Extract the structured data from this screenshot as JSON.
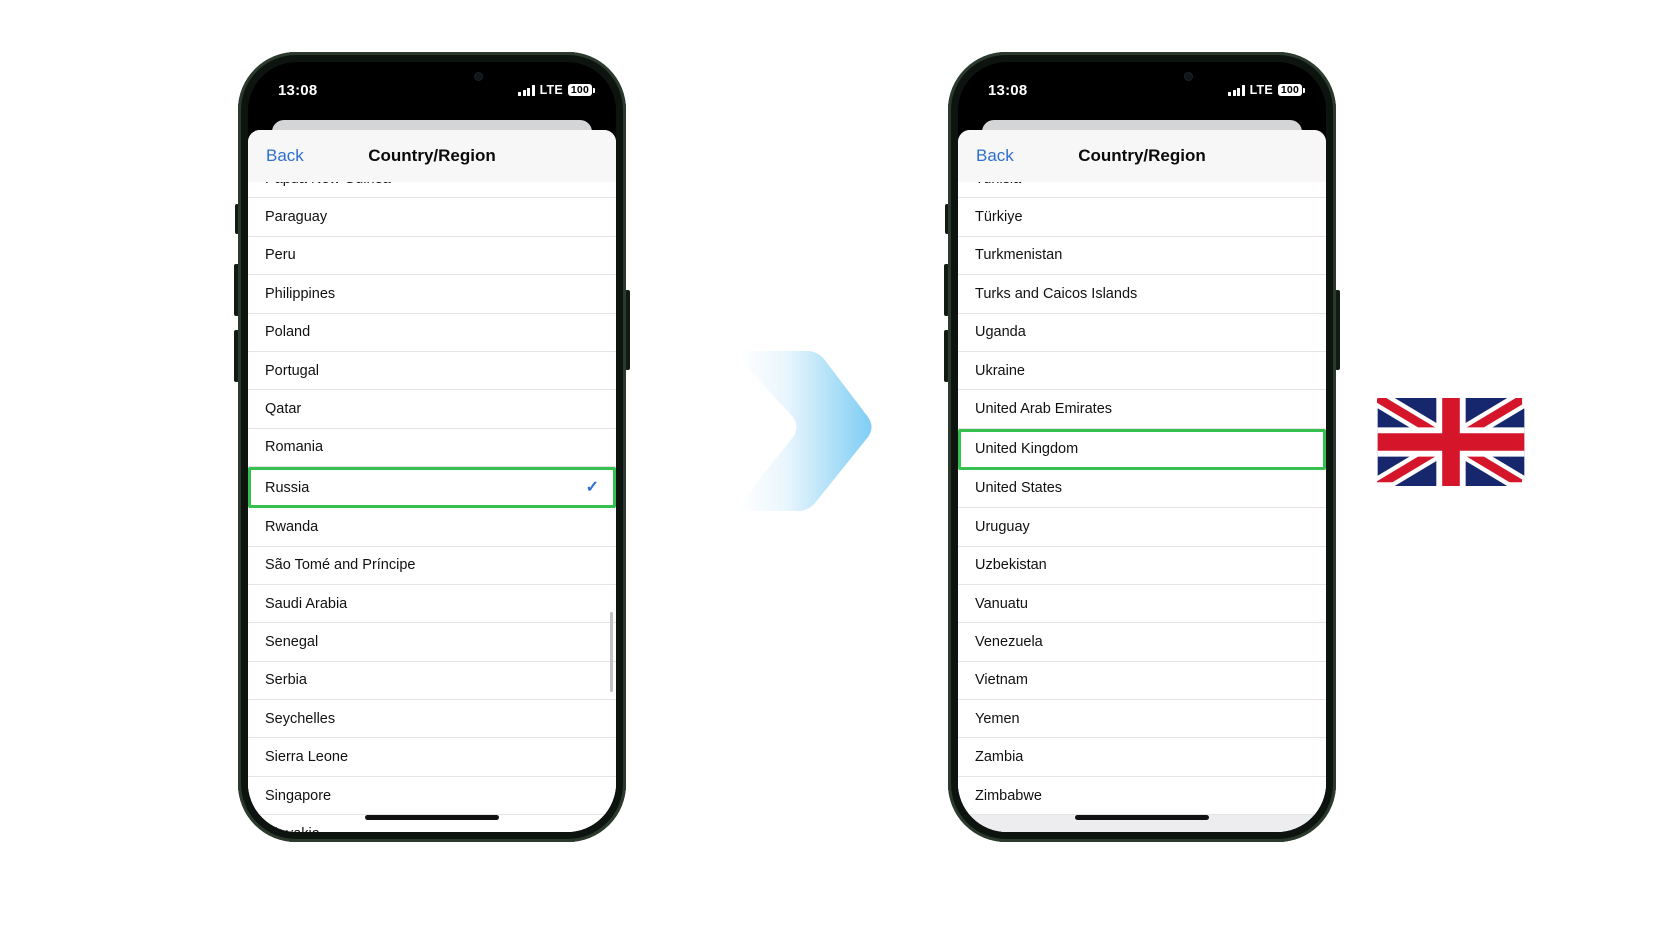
{
  "statusbar": {
    "time": "13:08",
    "network_label": "LTE",
    "battery_label": "100",
    "signal_icon": "cellular-bars-icon",
    "battery_icon": "battery-icon"
  },
  "navbar": {
    "back_label": "Back",
    "title": "Country/Region"
  },
  "left_phone": {
    "name": "iphone-before",
    "selected_country": "Russia",
    "checkmark_glyph": "✓",
    "rows": [
      {
        "label": "Papua New Guinea",
        "partial": true,
        "checked": false,
        "selected": false
      },
      {
        "label": "Paraguay",
        "partial": false,
        "checked": false,
        "selected": false
      },
      {
        "label": "Peru",
        "partial": false,
        "checked": false,
        "selected": false
      },
      {
        "label": "Philippines",
        "partial": false,
        "checked": false,
        "selected": false
      },
      {
        "label": "Poland",
        "partial": false,
        "checked": false,
        "selected": false
      },
      {
        "label": "Portugal",
        "partial": false,
        "checked": false,
        "selected": false
      },
      {
        "label": "Qatar",
        "partial": false,
        "checked": false,
        "selected": false
      },
      {
        "label": "Romania",
        "partial": false,
        "checked": false,
        "selected": false
      },
      {
        "label": "Russia",
        "partial": false,
        "checked": true,
        "selected": true
      },
      {
        "label": "Rwanda",
        "partial": false,
        "checked": false,
        "selected": false
      },
      {
        "label": "São Tomé and Príncipe",
        "partial": false,
        "checked": false,
        "selected": false
      },
      {
        "label": "Saudi Arabia",
        "partial": false,
        "checked": false,
        "selected": false
      },
      {
        "label": "Senegal",
        "partial": false,
        "checked": false,
        "selected": false
      },
      {
        "label": "Serbia",
        "partial": false,
        "checked": false,
        "selected": false
      },
      {
        "label": "Seychelles",
        "partial": false,
        "checked": false,
        "selected": false
      },
      {
        "label": "Sierra Leone",
        "partial": false,
        "checked": false,
        "selected": false
      },
      {
        "label": "Singapore",
        "partial": false,
        "checked": false,
        "selected": false
      },
      {
        "label": "Slovakia",
        "partial": true,
        "checked": false,
        "selected": false
      }
    ]
  },
  "right_phone": {
    "name": "iphone-after",
    "selected_country": "United Kingdom",
    "rows": [
      {
        "label": "Tunisia",
        "partial": true,
        "checked": false,
        "selected": false
      },
      {
        "label": "Türkiye",
        "partial": false,
        "checked": false,
        "selected": false
      },
      {
        "label": "Turkmenistan",
        "partial": false,
        "checked": false,
        "selected": false
      },
      {
        "label": "Turks and Caicos Islands",
        "partial": false,
        "checked": false,
        "selected": false
      },
      {
        "label": "Uganda",
        "partial": false,
        "checked": false,
        "selected": false
      },
      {
        "label": "Ukraine",
        "partial": false,
        "checked": false,
        "selected": false
      },
      {
        "label": "United Arab Emirates",
        "partial": false,
        "checked": false,
        "selected": false
      },
      {
        "label": "United Kingdom",
        "partial": false,
        "checked": false,
        "selected": true
      },
      {
        "label": "United States",
        "partial": false,
        "checked": false,
        "selected": false
      },
      {
        "label": "Uruguay",
        "partial": false,
        "checked": false,
        "selected": false
      },
      {
        "label": "Uzbekistan",
        "partial": false,
        "checked": false,
        "selected": false
      },
      {
        "label": "Vanuatu",
        "partial": false,
        "checked": false,
        "selected": false
      },
      {
        "label": "Venezuela",
        "partial": false,
        "checked": false,
        "selected": false
      },
      {
        "label": "Vietnam",
        "partial": false,
        "checked": false,
        "selected": false
      },
      {
        "label": "Yemen",
        "partial": false,
        "checked": false,
        "selected": false
      },
      {
        "label": "Zambia",
        "partial": false,
        "checked": false,
        "selected": false
      },
      {
        "label": "Zimbabwe",
        "partial": false,
        "checked": false,
        "selected": false
      }
    ]
  },
  "arrow": {
    "icon": "chevron-right-arrow-icon",
    "gradient_from": "#ffffff",
    "gradient_to": "#7fcdf4"
  },
  "flag": {
    "icon": "united-kingdom-flag-icon",
    "alt": "United Kingdom",
    "blue": "#16276e",
    "red": "#d5152a",
    "white": "#ffffff"
  },
  "colors": {
    "selection_outline": "#35c04f",
    "accent_blue": "#2f6fd0",
    "row_divider": "#e4e4e6",
    "navbar_bg": "#f7f7f8"
  }
}
